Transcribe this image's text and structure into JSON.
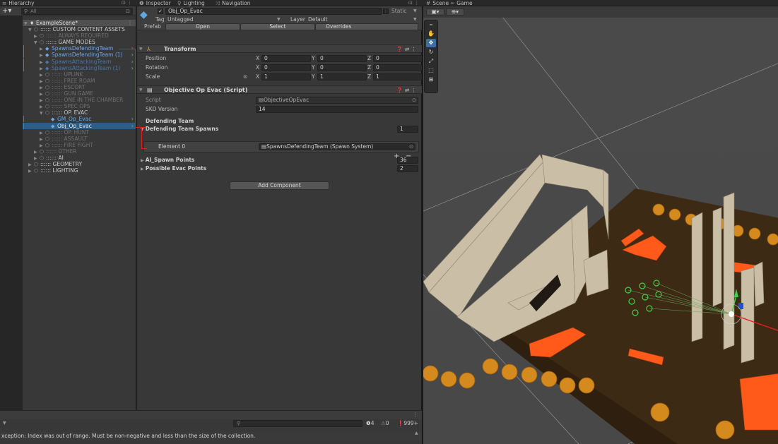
{
  "tabs": {
    "hierarchy": "Hierarchy",
    "inspector": "Inspector",
    "lighting": "Lighting",
    "navigation": "Navigation",
    "scene": "Scene",
    "game": "Game"
  },
  "hierarchy": {
    "search_placeholder": "All",
    "scene_name": "ExampleScene*",
    "rows": [
      {
        "label": ":::::: CUSTOM CONTENT ASSETS",
        "style": "normal",
        "indent": 1,
        "arrow": "▼"
      },
      {
        "label": ":::::: ALWAYS REQUIRED",
        "style": "dim",
        "indent": 2,
        "arrow": "▶"
      },
      {
        "label": ":::::: GAME MODES",
        "style": "normal",
        "indent": 2,
        "arrow": "▼"
      },
      {
        "label": "SpawnsDefendingTeam",
        "style": "blue",
        "indent": 3,
        "arrow": "▶"
      },
      {
        "label": "SpawnsDefendingTeam (1)",
        "style": "blue",
        "indent": 3,
        "arrow": "▶"
      },
      {
        "label": "SpawnsAttackingTeam",
        "style": "dimblue",
        "indent": 3,
        "arrow": "▶"
      },
      {
        "label": "SpawnsAttackingTeam (1)",
        "style": "dimblue",
        "indent": 3,
        "arrow": "▶"
      },
      {
        "label": ":::::: UPLINK",
        "style": "dim",
        "indent": 3,
        "arrow": "▶"
      },
      {
        "label": ":::::: FREE ROAM",
        "style": "dim",
        "indent": 3,
        "arrow": "▶"
      },
      {
        "label": ":::::: ESCORT",
        "style": "dim",
        "indent": 3,
        "arrow": "▶"
      },
      {
        "label": ":::::: GUN GAME",
        "style": "dim",
        "indent": 3,
        "arrow": "▶"
      },
      {
        "label": ":::::: ONE IN THE CHAMBER",
        "style": "dim",
        "indent": 3,
        "arrow": "▶"
      },
      {
        "label": ":::::: SPEC OPS",
        "style": "dim",
        "indent": 3,
        "arrow": "▶"
      },
      {
        "label": ":::::: OP. EVAC",
        "style": "normal",
        "indent": 3,
        "arrow": "▼"
      },
      {
        "label": "GM_Op_Evac",
        "style": "blue",
        "indent": 4,
        "arrow": ""
      },
      {
        "label": "Obj_Op_Evac",
        "style": "sel",
        "indent": 4,
        "arrow": ""
      },
      {
        "label": ":::::: OP. HUNT",
        "style": "dim",
        "indent": 3,
        "arrow": "▶"
      },
      {
        "label": ":::::: ASSAULT",
        "style": "dim",
        "indent": 3,
        "arrow": "▶"
      },
      {
        "label": ":::::: FIRE FIGHT",
        "style": "dim",
        "indent": 3,
        "arrow": "▶"
      },
      {
        "label": ":::::: OTHER",
        "style": "dim",
        "indent": 2,
        "arrow": "▶"
      },
      {
        "label": ":::::: AI",
        "style": "normal",
        "indent": 2,
        "arrow": "▶"
      },
      {
        "label": ":::::: GEOMETRY",
        "style": "normal",
        "indent": 1,
        "arrow": "▶"
      },
      {
        "label": ":::::: LIGHTING",
        "style": "normal",
        "indent": 1,
        "arrow": "▶"
      }
    ]
  },
  "inspector": {
    "object_name": "Obj_Op_Evac",
    "static_label": "Static",
    "tag_label": "Tag",
    "tag_value": "Untagged",
    "layer_label": "Layer",
    "layer_value": "Default",
    "prefab_label": "Prefab",
    "prefab_open": "Open",
    "prefab_select": "Select",
    "prefab_overrides": "Overrides",
    "transform": {
      "title": "Transform",
      "position_label": "Position",
      "rotation_label": "Rotation",
      "scale_label": "Scale",
      "position": {
        "x": "0",
        "y": "0",
        "z": "0"
      },
      "rotation": {
        "x": "0",
        "y": "0",
        "z": "0"
      },
      "scale": {
        "x": "1",
        "y": "1",
        "z": "1"
      }
    },
    "script_component": {
      "title": "Objective Op Evac (Script)",
      "script_label": "Script",
      "script_value": "ObjectiveOpEvac",
      "skd_label": "SKD Version",
      "skd_value": "14",
      "defending_team_header": "Defending Team",
      "defending_spawns_label": "Defending Team Spawns",
      "defending_spawns_count": "1",
      "element0_label": "Element 0",
      "element0_value": "SpawnsDefendingTeam (Spawn System)",
      "ai_spawn_label": "AI_Spawn Points",
      "ai_spawn_value": "36",
      "evac_label": "Possible Evac Points",
      "evac_value": "2"
    },
    "add_component": "Add Component"
  },
  "console": {
    "message": "xception: Index was out of range. Must be non-negative and less than the size of the collection.",
    "info_count": "4",
    "warn_count": "0",
    "error_count": "999+"
  },
  "colors": {
    "selection": "#2c5d87",
    "accent_blue": "#6ea8e6",
    "error_red": "#e02020",
    "floor": "#3d2a14",
    "orange_block": "#ff5a1a",
    "wall": "#c9bfa7"
  }
}
